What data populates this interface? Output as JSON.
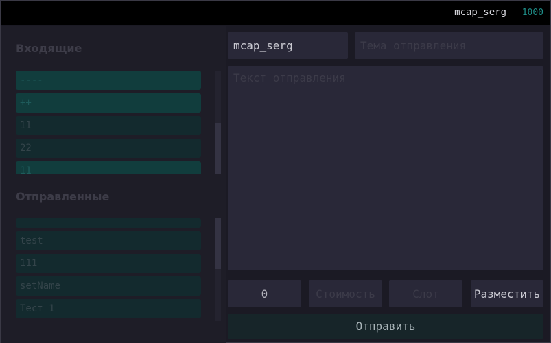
{
  "topbar": {
    "username": "mcap_serg",
    "balance": "1000"
  },
  "inbox": {
    "title": "Входящие",
    "items": [
      {
        "label": "----",
        "active": true
      },
      {
        "label": "++",
        "active": true
      },
      {
        "label": "11",
        "active": false
      },
      {
        "label": "22",
        "active": false
      },
      {
        "label": "11",
        "active": true
      }
    ]
  },
  "sent": {
    "title": "Отправленные",
    "items": [
      {
        "label": "test"
      },
      {
        "label": "111"
      },
      {
        "label": "setName"
      },
      {
        "label": "Тест 1"
      }
    ]
  },
  "compose": {
    "recipient_value": "mcap_serg",
    "subject_placeholder": "Тема отправления",
    "body_placeholder": "Текст отправления",
    "quantity_value": "0",
    "cost_placeholder": "Стоимость",
    "slot_placeholder": "Слот",
    "place_label": "Разместить",
    "send_label": "Отправить"
  },
  "colors": {
    "accent": "#1f8f8a",
    "active_item": "#113d3d",
    "item": "#132a2e",
    "field": "#292838",
    "background": "#1b1a24"
  }
}
